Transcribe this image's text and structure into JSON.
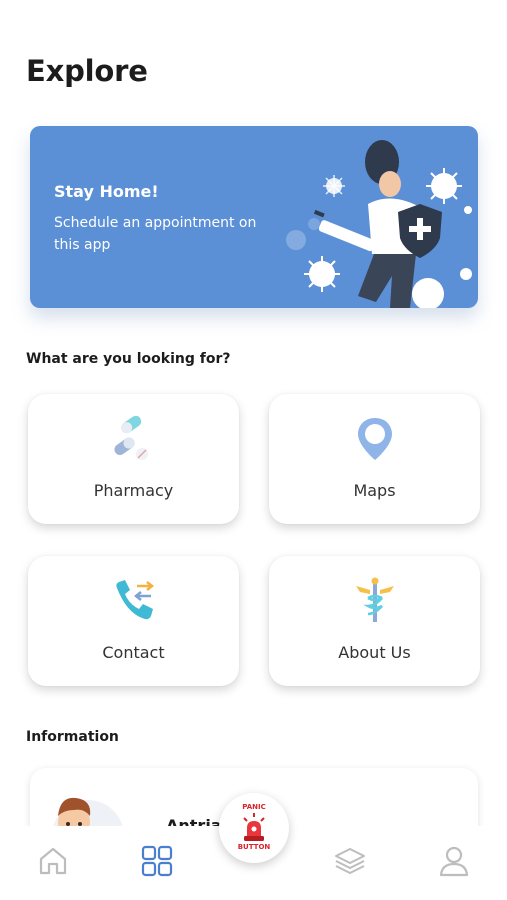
{
  "page": {
    "title": "Explore"
  },
  "banner": {
    "title": "Stay Home!",
    "text": "Schedule an appointment on this app",
    "color": "#5b8fd6"
  },
  "services": {
    "heading": "What are you looking for?",
    "items": [
      {
        "label": "Pharmacy",
        "icon": "pills-icon"
      },
      {
        "label": "Maps",
        "icon": "map-pin-icon"
      },
      {
        "label": "Contact",
        "icon": "phone-call-icon"
      },
      {
        "label": "About Us",
        "icon": "caduceus-icon"
      }
    ]
  },
  "information": {
    "heading": "Information",
    "card_title": "Antria      t Jalan"
  },
  "panic_button": {
    "top_label": "PANIC",
    "bottom_label": "BUTTON",
    "color": "#d7252b"
  },
  "bottom_nav": {
    "items": [
      {
        "icon": "home-icon",
        "active": false
      },
      {
        "icon": "grid-icon",
        "active": true
      },
      {
        "icon": "layers-icon",
        "active": false
      },
      {
        "icon": "user-icon",
        "active": false
      }
    ],
    "active_color": "#4a7fcf",
    "inactive_color": "#bdbdbd"
  }
}
